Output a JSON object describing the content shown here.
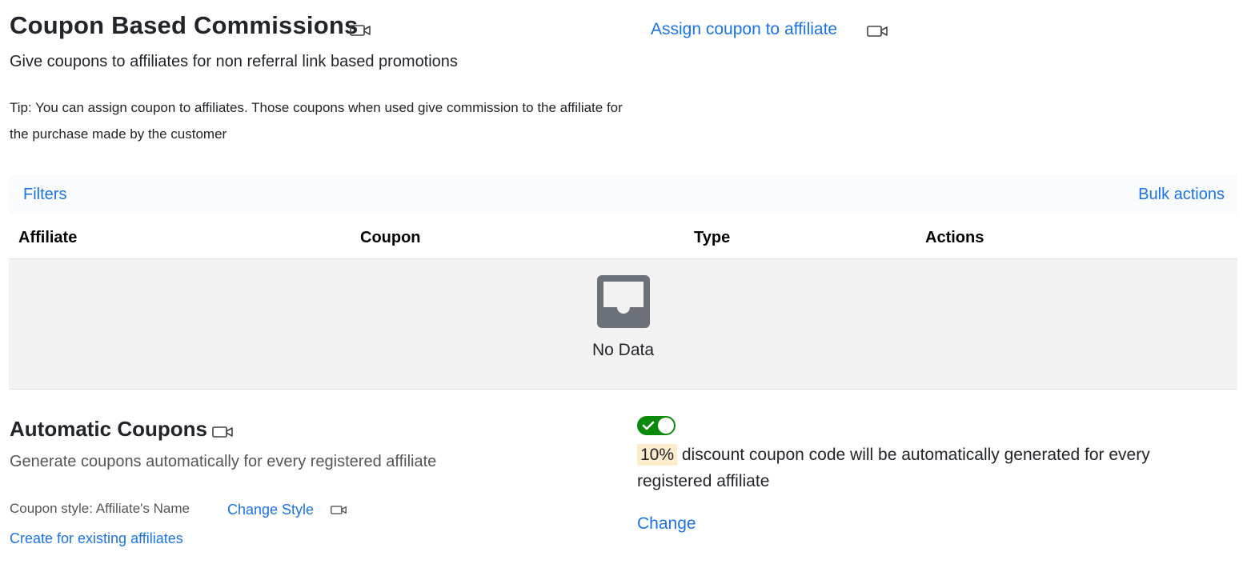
{
  "header": {
    "title": "Coupon Based Commissions",
    "title_icon": "video-camera-icon",
    "subtitle": "Give coupons to affiliates for non referral link based promotions",
    "tip": "Tip: You can assign coupon to affiliates. Those coupons when used give commission to the affiliate for the purchase made by the customer",
    "assign_link": "Assign coupon to affiliate",
    "assign_icon": "video-camera-icon"
  },
  "toolbar": {
    "filters_label": "Filters",
    "bulk_actions_label": "Bulk actions"
  },
  "table": {
    "columns": [
      "Affiliate",
      "Coupon",
      "Type",
      "Actions"
    ],
    "rows": [],
    "empty_icon": "inbox-icon",
    "empty_text": "No Data"
  },
  "automatic": {
    "title": "Automatic Coupons",
    "title_icon": "video-camera-icon",
    "subtitle": "Generate coupons automatically for every registered affiliate",
    "style_label": "Coupon style: Affiliate's Name",
    "change_style": "Change Style",
    "create_existing": "Create for existing affiliates",
    "toggle_enabled": true,
    "discount_percent": "10%",
    "discount_text": "discount coupon code will be automatically generated for every registered affiliate",
    "change_label": "Change"
  },
  "colors": {
    "link": "#1a73e8",
    "toggle_on": "#0b8a0b",
    "highlight": "#fdeccc",
    "empty_bg": "#f2f2f2"
  }
}
